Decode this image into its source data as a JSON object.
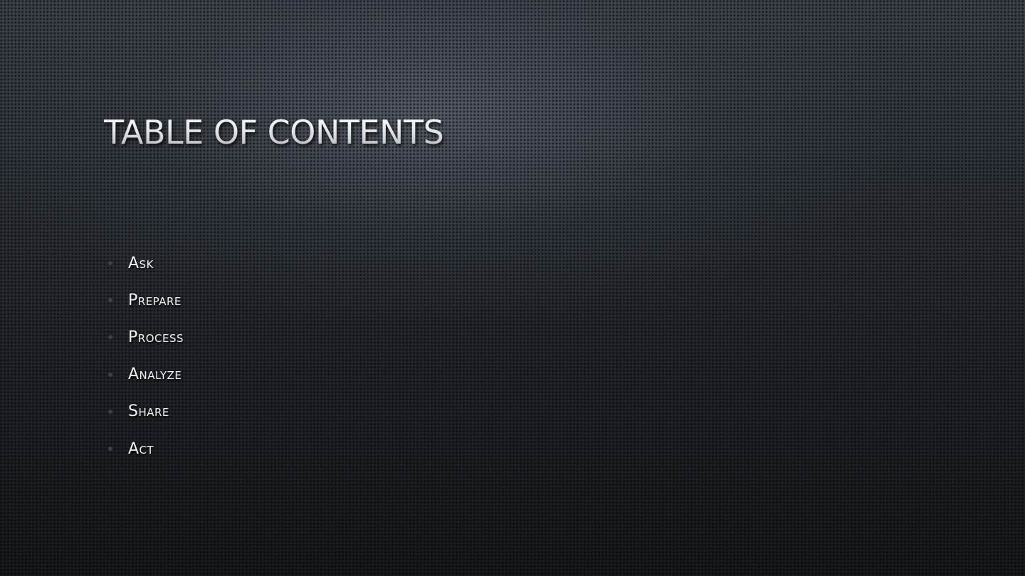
{
  "slide": {
    "title": "Table of Contents",
    "items": [
      {
        "label": "Ask"
      },
      {
        "label": "Prepare"
      },
      {
        "label": "Process"
      },
      {
        "label": "Analyze"
      },
      {
        "label": "Share"
      },
      {
        "label": "Act"
      }
    ]
  },
  "theme": {
    "background": "#1e2126",
    "title_color": "#e6e7e9",
    "text_color": "#f2f3f4",
    "bullet_color": "#3c4048"
  }
}
